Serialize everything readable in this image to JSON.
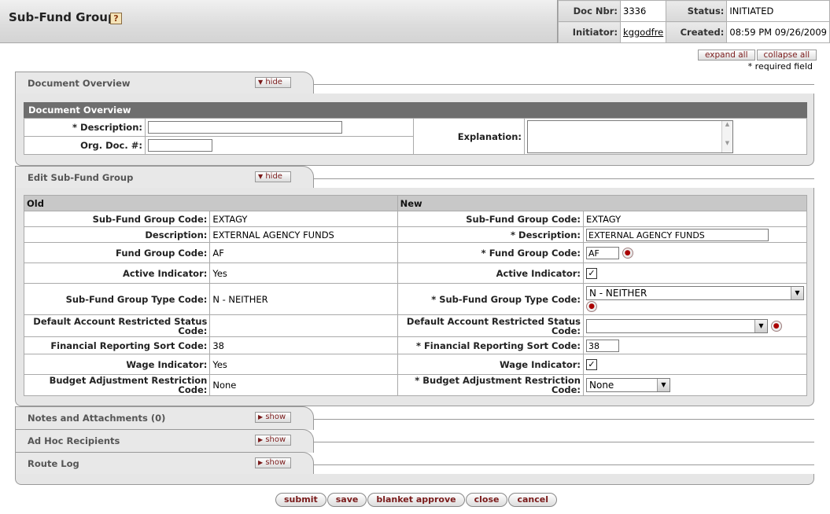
{
  "header": {
    "title": "Sub-Fund Group",
    "help_icon": "?",
    "doc_nbr_label": "Doc Nbr:",
    "doc_nbr": "3336",
    "status_label": "Status:",
    "status": "INITIATED",
    "initiator_label": "Initiator:",
    "initiator": "kggodfre",
    "created_label": "Created:",
    "created": "08:59 PM 09/26/2009"
  },
  "controls": {
    "expand_all": "expand all",
    "collapse_all": "collapse all",
    "required_note": "* required field"
  },
  "document_overview": {
    "tab_label": "Document Overview",
    "toggle": "hide",
    "section_title": "Document Overview",
    "description_label": "* Description:",
    "description_value": "",
    "org_doc_label": "Org. Doc. #:",
    "org_doc_value": "",
    "explanation_label": "Explanation:",
    "explanation_value": ""
  },
  "edit": {
    "tab_label": "Edit Sub-Fund Group",
    "toggle": "hide",
    "old_header": "Old",
    "new_header": "New",
    "rows": [
      {
        "old_label": "Sub-Fund Group Code:",
        "old_value": "EXTAGY",
        "new_label": "Sub-Fund Group Code:",
        "new_value": "EXTAGY"
      },
      {
        "old_label": "Description:",
        "old_value": "EXTERNAL AGENCY FUNDS",
        "new_label": "* Description:",
        "new_value": "EXTERNAL AGENCY FUNDS"
      },
      {
        "old_label": "Fund Group Code:",
        "old_value": "AF",
        "new_label": "* Fund Group Code:",
        "new_value": "AF"
      },
      {
        "old_label": "Active Indicator:",
        "old_value": "Yes",
        "new_label": "Active Indicator:",
        "new_value": "✓"
      },
      {
        "old_label": "Sub-Fund Group Type Code:",
        "old_value": "N - NEITHER",
        "new_label": "* Sub-Fund Group Type Code:",
        "new_value": "N -  NEITHER"
      },
      {
        "old_label": "Default Account Restricted Status Code:",
        "old_value": "",
        "new_label": "Default Account Restricted Status Code:",
        "new_value": ""
      },
      {
        "old_label": "Financial Reporting Sort Code:",
        "old_value": "38",
        "new_label": "* Financial Reporting Sort Code:",
        "new_value": "38"
      },
      {
        "old_label": "Wage Indicator:",
        "old_value": "Yes",
        "new_label": "Wage Indicator:",
        "new_value": "✓"
      },
      {
        "old_label": "Budget Adjustment Restriction Code:",
        "old_value": "None",
        "new_label": "* Budget Adjustment Restriction Code:",
        "new_value": "None"
      }
    ]
  },
  "notes": {
    "tab_label": "Notes and Attachments (0)",
    "toggle": "show"
  },
  "adhoc": {
    "tab_label": "Ad Hoc Recipients",
    "toggle": "show"
  },
  "routelog": {
    "tab_label": "Route Log",
    "toggle": "show"
  },
  "footer": {
    "submit": "submit",
    "save": "save",
    "blanket_approve": "blanket approve",
    "close": "close",
    "cancel": "cancel"
  }
}
